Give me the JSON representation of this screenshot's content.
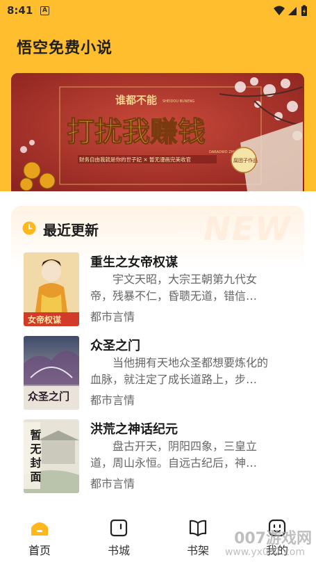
{
  "status_bar": {
    "time": "8:41",
    "notification_icon_letter": "A",
    "icons": [
      "wifi-icon",
      "signal-icon",
      "battery-icon"
    ]
  },
  "app": {
    "title": "悟空免费小说"
  },
  "banner": {
    "small_title": "谁都不能",
    "main_title": "打扰我赚钱",
    "tagline": "财务自由我就是你的世子妃 × 暂无漫画完美收官",
    "badge": "腐团子作品",
    "pinyin_top": "SHEIDOU BUNENG",
    "pinyin_side": "DARAOWO ZHUANQIAN"
  },
  "section": {
    "title": "最近更新",
    "ghost_text": "NEW"
  },
  "books": [
    {
      "title": "重生之女帝权谋",
      "desc": "宇文天昭，大宗王朝第九代女帝，残暴不仁，昏聩无道，错信…",
      "category": "都市言情",
      "cover_text": "女帝权谋"
    },
    {
      "title": "众圣之门",
      "desc": "当他拥有天地众圣都想要炼化的血脉，就注定了成长道路上，步…",
      "category": "都市言情",
      "cover_text": "众圣之门"
    },
    {
      "title": "洪荒之神话纪元",
      "desc": "盘古开天，阴阳四象，三皇立道，周山永恒。自远古纪后，神…",
      "category": "都市言情",
      "cover_text": "暂无封面"
    }
  ],
  "tabs": [
    {
      "label": "首页",
      "icon": "home-icon",
      "active": true
    },
    {
      "label": "书城",
      "icon": "bookstore-icon",
      "active": false
    },
    {
      "label": "书架",
      "icon": "bookshelf-icon",
      "active": false
    },
    {
      "label": "我的",
      "icon": "profile-icon",
      "active": false
    }
  ],
  "watermark": {
    "main": "007游戏网",
    "sub": "www.yx007.com"
  },
  "colors": {
    "accent": "#FFBE2E",
    "banner_red": "#A9312A",
    "text_gray": "#666666"
  }
}
